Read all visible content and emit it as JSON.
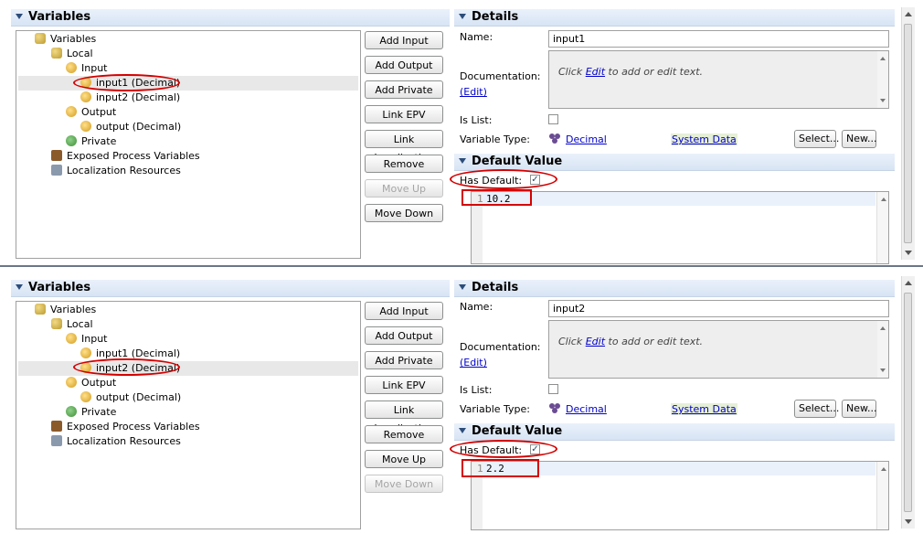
{
  "panels": [
    {
      "variables_title": "Variables",
      "tree": {
        "variables": "Variables",
        "local": "Local",
        "input": "Input",
        "input1": "input1 (Decimal)",
        "input2": "input2 (Decimal)",
        "output": "Output",
        "output_var": "output (Decimal)",
        "private": "Private",
        "epv": "Exposed Process Variables",
        "loc": "Localization Resources"
      },
      "buttons": {
        "add_input": "Add Input",
        "add_output": "Add Output",
        "add_private": "Add Private",
        "link_epv": "Link EPV",
        "link_localization": "Link Localization",
        "remove": "Remove",
        "move_up": "Move Up",
        "move_down": "Move Down"
      },
      "details": {
        "title": "Details",
        "name_label": "Name:",
        "name_value": "input1",
        "doc_label": "Documentation:",
        "doc_edit_link": "(Edit)",
        "doc_hint_pre": "Click",
        "doc_hint_link": "Edit",
        "doc_hint_post": "to add or edit text.",
        "is_list_label": "Is List:",
        "var_type_label": "Variable Type:",
        "var_type_value": "Decimal",
        "system_data": "System Data",
        "select_btn": "Select...",
        "new_btn": "New..."
      },
      "default_value": {
        "title": "Default Value",
        "has_default_label": "Has Default:",
        "line_number": "1",
        "value": "10.2"
      }
    },
    {
      "variables_title": "Variables",
      "tree": {
        "variables": "Variables",
        "local": "Local",
        "input": "Input",
        "input1": "input1 (Decimal)",
        "input2": "input2 (Decimal)",
        "output": "Output",
        "output_var": "output (Decimal)",
        "private": "Private",
        "epv": "Exposed Process Variables",
        "loc": "Localization Resources"
      },
      "buttons": {
        "add_input": "Add Input",
        "add_output": "Add Output",
        "add_private": "Add Private",
        "link_epv": "Link EPV",
        "link_localization": "Link Localization",
        "remove": "Remove",
        "move_up": "Move Up",
        "move_down": "Move Down"
      },
      "details": {
        "title": "Details",
        "name_label": "Name:",
        "name_value": "input2",
        "doc_label": "Documentation:",
        "doc_edit_link": "(Edit)",
        "doc_hint_pre": "Click",
        "doc_hint_link": "Edit",
        "doc_hint_post": "to add or edit text.",
        "is_list_label": "Is List:",
        "var_type_label": "Variable Type:",
        "var_type_value": "Decimal",
        "system_data": "System Data",
        "select_btn": "Select...",
        "new_btn": "New..."
      },
      "default_value": {
        "title": "Default Value",
        "has_default_label": "Has Default:",
        "line_number": "1",
        "value": "2.2"
      }
    }
  ],
  "colors": {
    "annotation": "#d40000",
    "link": "#0000cc",
    "header_bg": "#d7e4f4"
  },
  "icons": {
    "variables": "variables-folder-icon",
    "input": "input-arrow-icon",
    "output": "output-arrow-icon",
    "private": "private-circle-icon",
    "epv": "epv-icon",
    "localization": "localization-icon",
    "type": "decimal-type-icon"
  }
}
